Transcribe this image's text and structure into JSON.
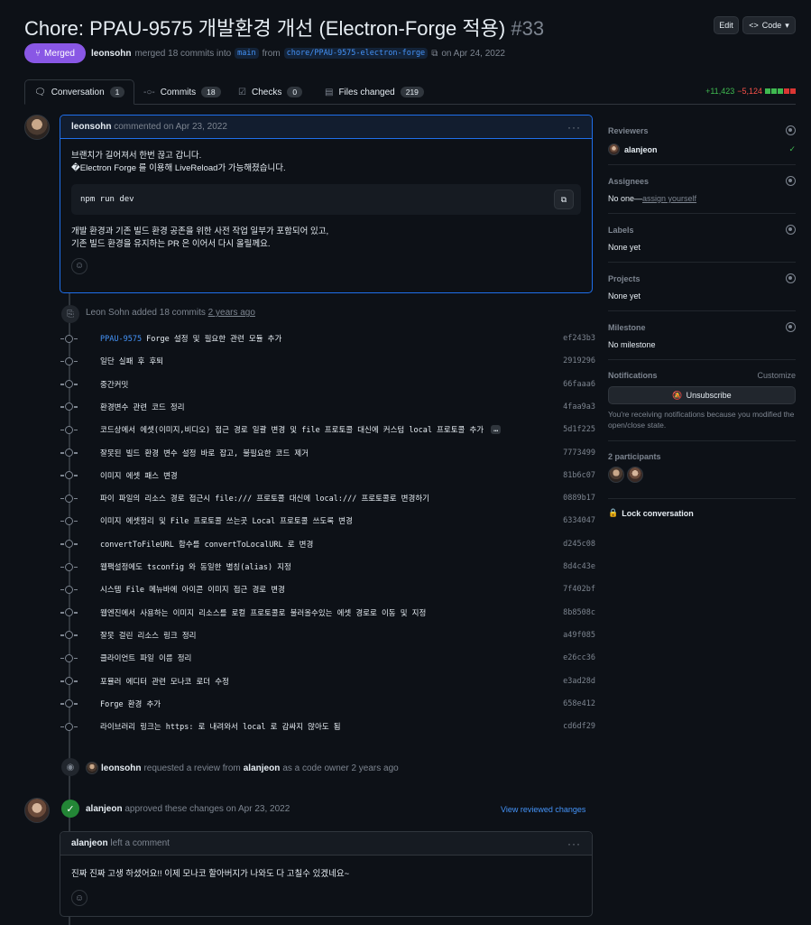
{
  "pr": {
    "title": "Chore: PPAU-9575 개발환경 개선 (Electron-Forge 적용)",
    "number": "#33",
    "state": "Merged",
    "author": "leonsohn",
    "merge_text": "merged 18 commits into",
    "base": "main",
    "from": "from",
    "head": "chore/PPAU-9575-electron-forge",
    "date": "on Apr 24, 2022"
  },
  "header_buttons": {
    "edit": "Edit",
    "code": "Code"
  },
  "tabs": [
    {
      "label": "Conversation",
      "count": "1"
    },
    {
      "label": "Commits",
      "count": "18"
    },
    {
      "label": "Checks",
      "count": "0"
    },
    {
      "label": "Files changed",
      "count": "219"
    }
  ],
  "diffstat": {
    "add": "+11,423",
    "del": "−5,124"
  },
  "first_comment": {
    "author": "leonsohn",
    "meta": "commented on Apr 23, 2022",
    "line1": "브랜치가 길어져서 한번 끊고 갑니다.",
    "line2": "�Electron Forge 를 이용해 LiveReload가 가능해졌습니다.",
    "code": "npm run dev",
    "line3": "개발 환경과 기존 빌드 환경 공존을 위한 사전 작업 일부가 포함되어 있고,",
    "line4": "기존 빌드 환경을 유지하는 PR 은 이어서 다시 올릴께요."
  },
  "commits_event": {
    "actor": "Leon Sohn",
    "text": "added 18 commits",
    "time": "2 years ago"
  },
  "commits": [
    {
      "ref": "PPAU-9575",
      "msg": " Forge 설정 및 필요한 관련 모듈 추가",
      "sha": "ef243b3"
    },
    {
      "ref": "",
      "msg": "일단 실패 후 후퇴",
      "sha": "2919296"
    },
    {
      "ref": "",
      "msg": "중간커밋",
      "sha": "66faaa6"
    },
    {
      "ref": "",
      "msg": "환경변수 관련 코드 정리",
      "sha": "4faa9a3"
    },
    {
      "ref": "",
      "msg": "코드상에서 에셋(이미지,비디오) 접근 경로 일괄 변경 및 file 프로토콜 대신에 커스텀 local 프로토콜 추가",
      "sha": "5d1f225"
    },
    {
      "ref": "",
      "msg": "잘못된 빌드 환경 변수 설정 바로 잡고, 불필요한 코드 제거",
      "sha": "7773499"
    },
    {
      "ref": "",
      "msg": "이미지 에셋 패스 변경",
      "sha": "81b6c07"
    },
    {
      "ref": "",
      "msg": "파이 파일의 리소스 경로 접근시 file:/// 프로토콜 대신에 local:/// 프로토콜로 변경하기",
      "sha": "0889b17"
    },
    {
      "ref": "",
      "msg": "이미지 에셋정리 및 File 프로토콜 쓰는곳 Local 프로토콜 쓰도록 변경",
      "sha": "6334047"
    },
    {
      "ref": "",
      "msg": "convertToFileURL 함수를 convertToLocalURL 로 변경",
      "sha": "d245c08"
    },
    {
      "ref": "",
      "msg": "웹팩설정에도 tsconfig 와 동일한 별칭(alias) 지정",
      "sha": "8d4c43e"
    },
    {
      "ref": "",
      "msg": "시스템 File 메뉴바에 아이콘 이미지 접근 경로 변경",
      "sha": "7f402bf"
    },
    {
      "ref": "",
      "msg": "웹엔진에서 사용하는 이미지 리소스를 로컬 프로토콜로 불러올수있는 에셋 경로로 이동 및 지정",
      "sha": "8b8508c"
    },
    {
      "ref": "",
      "msg": "잘못 걸린 리소스 링크 정리",
      "sha": "a49f085"
    },
    {
      "ref": "",
      "msg": "클라이언트 파일 이름 정리",
      "sha": "e26cc36"
    },
    {
      "ref": "",
      "msg": "포뮬러 에디터 관련 모나코 로더 수정",
      "sha": "e3ad28d"
    },
    {
      "ref": "",
      "msg": "Forge 환경 추가",
      "sha": "658e412"
    },
    {
      "ref": "",
      "msg": "라이브러리 링크는 https: 로 내려와서 local 로 감싸지 않아도 됨",
      "sha": "cd6df29"
    }
  ],
  "review_request": {
    "actor": "leonsohn",
    "text": "requested a review from",
    "reviewer": "alanjeon",
    "suffix": "as a code owner 2 years ago"
  },
  "approval": {
    "actor": "alanjeon",
    "text": "approved these changes on Apr 23, 2022",
    "link": "View reviewed changes"
  },
  "review_comment": {
    "author": "alanjeon",
    "meta": "left a comment",
    "body": "진짜 진짜 고생 하셨어요!! 이제 모나코 할아버지가 나와도 다 고칠수 있겠네요~"
  },
  "sidebar": {
    "reviewers": {
      "label": "Reviewers",
      "name": "alanjeon"
    },
    "assignees": {
      "label": "Assignees",
      "none": "No one—",
      "assign": "assign yourself"
    },
    "labels": {
      "label": "Labels",
      "value": "None yet"
    },
    "projects": {
      "label": "Projects",
      "value": "None yet"
    },
    "milestone": {
      "label": "Milestone",
      "value": "No milestone"
    },
    "notifications": {
      "label": "Notifications",
      "customize": "Customize",
      "button": "Unsubscribe",
      "note": "You're receiving notifications because you modified the open/close state."
    },
    "participants": {
      "label": "2 participants"
    },
    "lock": "Lock conversation"
  },
  "colors": {
    "bg": "#0d1117",
    "merged": "#8957e5",
    "link": "#4493f8",
    "add": "#3fb950",
    "del": "#f85149",
    "approve": "#238636"
  }
}
